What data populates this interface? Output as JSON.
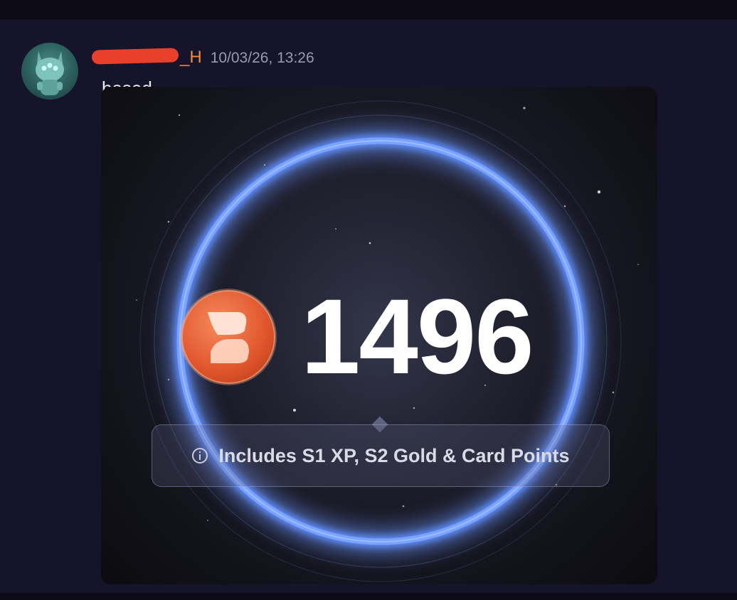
{
  "message": {
    "username": "_H",
    "timestamp": "10/03/26, 13:26",
    "text": "based"
  },
  "card": {
    "score": "1496",
    "info_text": "Includes S1 XP, S2 Gold & Card Points",
    "coin_icon": "b-logo-coin-icon",
    "info_icon": "info-icon"
  },
  "colors": {
    "username": "#f28c3a",
    "ring": "#5e8fff",
    "coin": "#e8643c",
    "background": "#15142a"
  }
}
